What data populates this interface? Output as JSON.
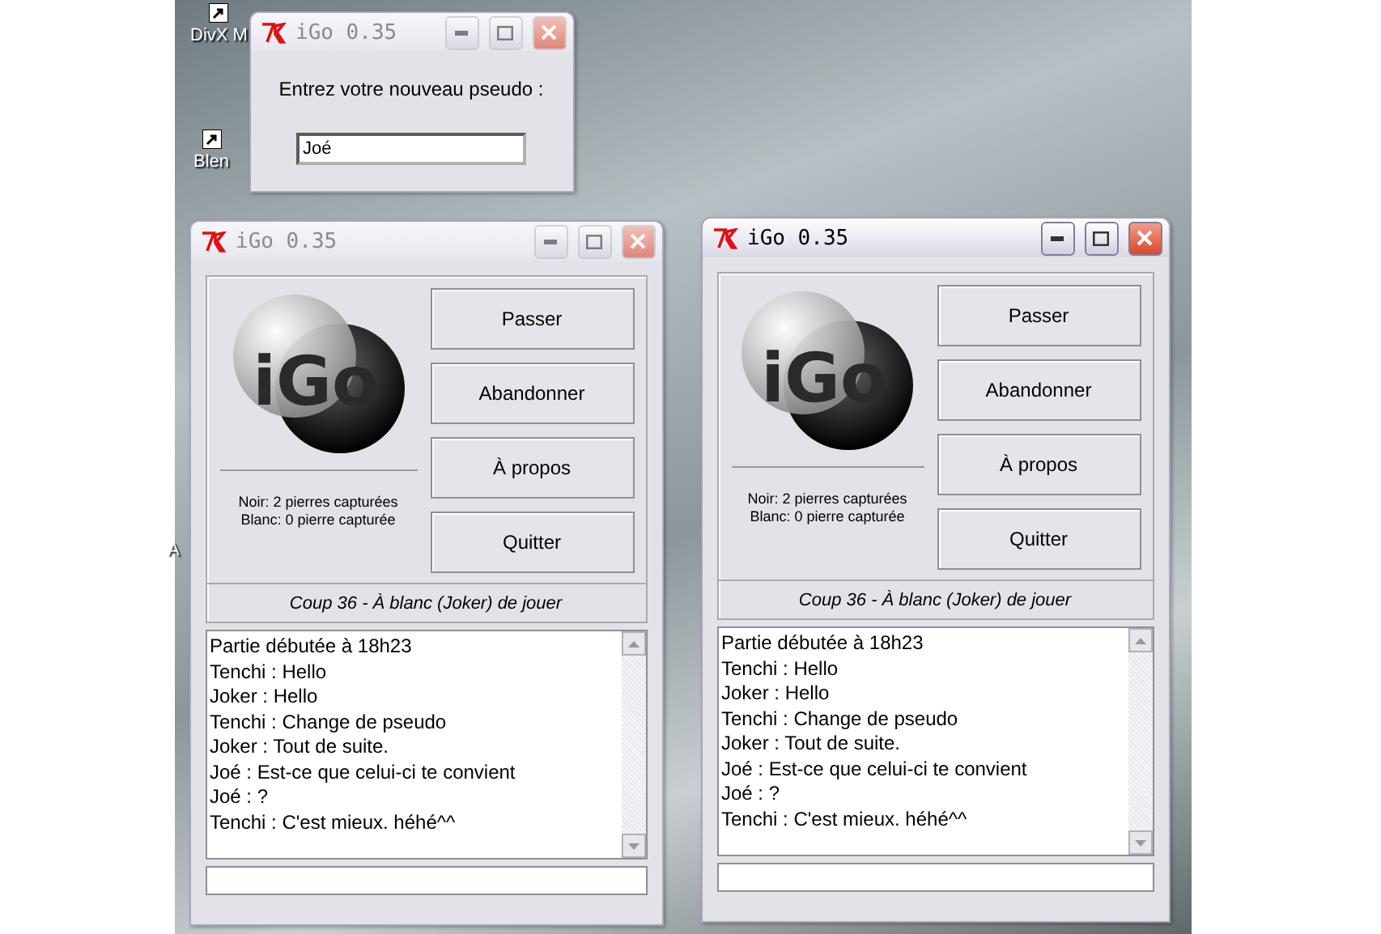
{
  "desktop": {
    "icons": [
      {
        "label": "DivX M"
      },
      {
        "label": "Blen"
      },
      {
        "label": "A"
      }
    ]
  },
  "dialog": {
    "title": "iGo 0.35",
    "active": false,
    "prompt": "Entrez votre nouveau pseudo :",
    "value": "Joé"
  },
  "windows": [
    {
      "title": "iGo 0.35",
      "active": false,
      "logo": "iGo",
      "captures": [
        "Noir: 2 pierres capturées",
        "Blanc: 0 pierre capturée"
      ],
      "buttons": [
        "Passer",
        "Abandonner",
        "À propos",
        "Quitter"
      ],
      "status": "Coup 36 - À blanc (Joker) de jouer",
      "chat": [
        "Partie débutée à 18h23",
        "Tenchi : Hello",
        "Joker : Hello",
        "Tenchi : Change de pseudo",
        "Joker : Tout de suite.",
        "Joé : Est-ce que celui-ci te convient",
        "Joé : ?",
        "Tenchi : C'est mieux. héhé^^"
      ]
    },
    {
      "title": "iGo 0.35",
      "active": true,
      "logo": "iGo",
      "captures": [
        "Noir: 2 pierres capturées",
        "Blanc: 0 pierre capturée"
      ],
      "buttons": [
        "Passer",
        "Abandonner",
        "À propos",
        "Quitter"
      ],
      "status": "Coup 36 - À blanc (Joker) de jouer",
      "chat": [
        "Partie débutée à 18h23",
        "Tenchi : Hello",
        "Joker : Hello",
        "Tenchi : Change de pseudo",
        "Joker : Tout de suite.",
        "Joé : Est-ce que celui-ci te convient",
        "Joé : ?",
        "Tenchi : C'est mieux. héhé^^"
      ]
    }
  ]
}
